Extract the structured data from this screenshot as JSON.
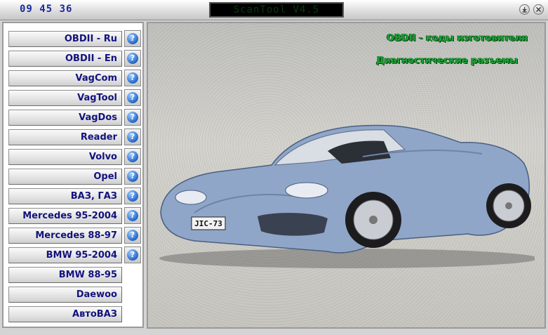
{
  "titlebar": {
    "clock": "09 45 36",
    "title": "ScanTool V4.5"
  },
  "sidebar": {
    "items": [
      {
        "label": "OBDII - Ru",
        "help": true
      },
      {
        "label": "OBDII - En",
        "help": true
      },
      {
        "label": "VagCom",
        "help": true
      },
      {
        "label": "VagTool",
        "help": true
      },
      {
        "label": "VagDos",
        "help": true
      },
      {
        "label": "Reader",
        "help": true
      },
      {
        "label": "Volvo",
        "help": true
      },
      {
        "label": "Opel",
        "help": true
      },
      {
        "label": "ВАЗ, ГАЗ",
        "help": true
      },
      {
        "label": "Mercedes 95-2004",
        "help": true
      },
      {
        "label": "Mercedes 88-97",
        "help": true
      },
      {
        "label": "BMW 95-2004",
        "help": true
      },
      {
        "label": "BMW 88-95",
        "help": false
      },
      {
        "label": "Daewoo",
        "help": false
      },
      {
        "label": "АвтоВАЗ",
        "help": false
      }
    ],
    "help_symbol": "?"
  },
  "main": {
    "links": [
      "OBDII - коды изготовителя",
      "Диагностические разъемы"
    ],
    "plate": "JIC-73"
  },
  "colors": {
    "button_text": "#12127e",
    "link_text": "#22a03a",
    "car_body": "#8fa6c8"
  }
}
